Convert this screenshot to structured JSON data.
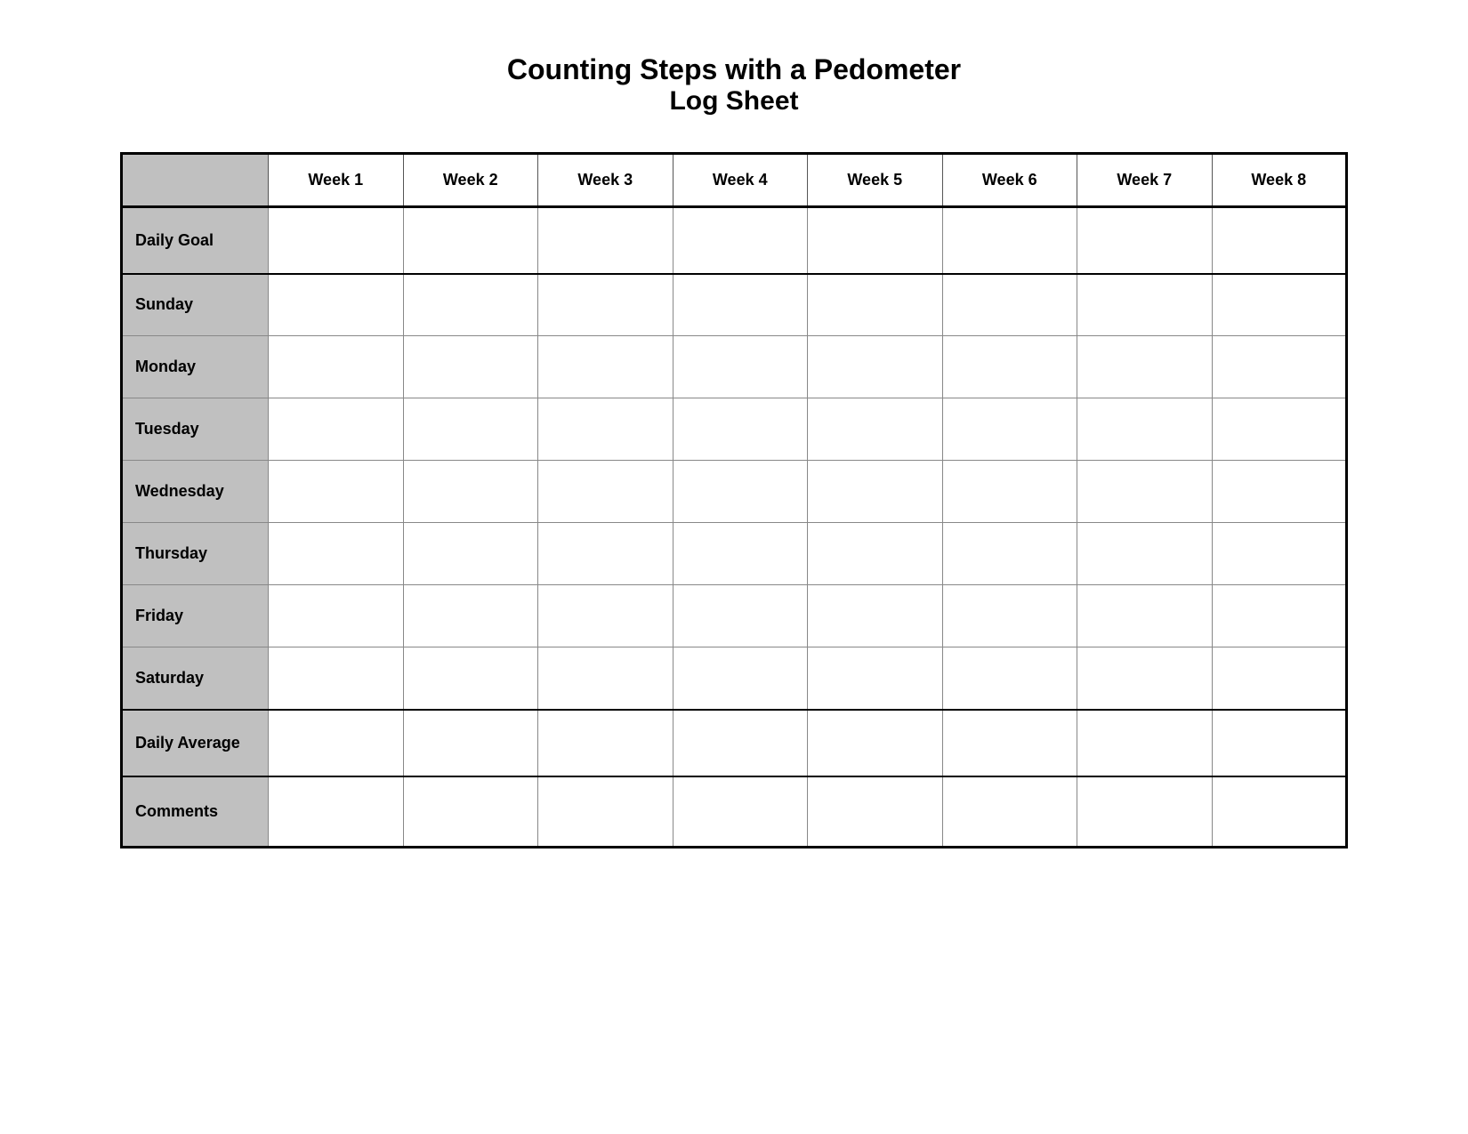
{
  "title": {
    "main": "Counting Steps with a Pedometer",
    "sub": "Log Sheet"
  },
  "table": {
    "header": {
      "row_label": "",
      "weeks": [
        "Week 1",
        "Week 2",
        "Week 3",
        "Week 4",
        "Week 5",
        "Week 6",
        "Week 7",
        "Week 8"
      ]
    },
    "rows": [
      {
        "label": "Daily Goal"
      },
      {
        "label": "Sunday"
      },
      {
        "label": "Monday"
      },
      {
        "label": "Tuesday"
      },
      {
        "label": "Wednesday"
      },
      {
        "label": "Thursday"
      },
      {
        "label": "Friday"
      },
      {
        "label": "Saturday"
      },
      {
        "label": "Daily Average"
      },
      {
        "label": "Comments"
      }
    ]
  }
}
